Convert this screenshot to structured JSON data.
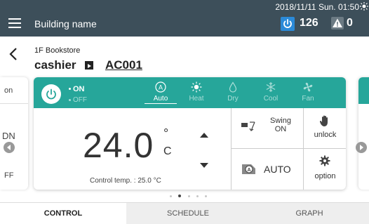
{
  "header": {
    "building_name": "Building name",
    "datetime": "2018/11/11 Sun. 01:50",
    "on_count": "126",
    "warning_count": "0"
  },
  "breadcrumb": {
    "floor": "1F Bookstore",
    "device_name": "cashier",
    "device_id": "AC001"
  },
  "left_peek": {
    "top": "on",
    "mid": "DN",
    "bottom": "FF"
  },
  "control": {
    "on_label": "ON",
    "off_label": "OFF",
    "modes": [
      {
        "label": "Auto",
        "icon": "auto-mode-icon",
        "active": true
      },
      {
        "label": "Heat",
        "icon": "sun-icon",
        "active": false
      },
      {
        "label": "Dry",
        "icon": "droplet-icon",
        "active": false
      },
      {
        "label": "Cool",
        "icon": "snowflake-icon",
        "active": false
      },
      {
        "label": "Fan",
        "icon": "fan-icon",
        "active": false
      }
    ],
    "set_temp": "24.0",
    "temp_degree": "°",
    "temp_unit": "C",
    "control_temp": "Control temp. : 25.0 °C",
    "swing_label": "Swing",
    "swing_state": "ON",
    "unlock_label": "unlock",
    "fan_speed": "AUTO",
    "option_label": "option"
  },
  "pager": {
    "pages": 5,
    "current": 1
  },
  "tabs": [
    {
      "label": "CONTROL",
      "active": true
    },
    {
      "label": "SCHEDULE",
      "active": false
    },
    {
      "label": "GRAPH",
      "active": false
    }
  ],
  "colors": {
    "header_bg": "#3d4f5a",
    "accent": "#26a69a",
    "power_blue": "#2b8ad8"
  }
}
